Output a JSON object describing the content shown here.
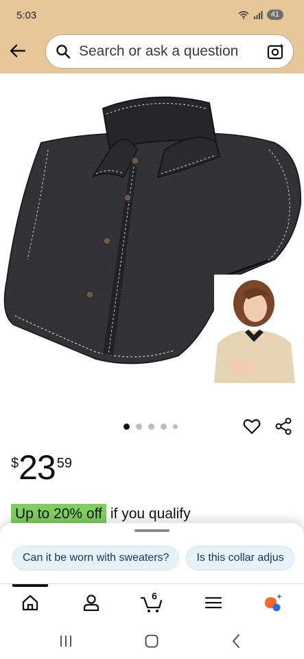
{
  "status_bar": {
    "time": "5:03",
    "battery": "41"
  },
  "search": {
    "placeholder": "Search or ask a question"
  },
  "product": {
    "carousel_dots": 5,
    "active_dot": 0,
    "price": {
      "symbol": "$",
      "whole": "23",
      "fraction": "59"
    },
    "deal": {
      "badge": "Up to 20% off",
      "text": "if you qualify"
    }
  },
  "suggestions": [
    "Can it be worn with sweaters?",
    "Is this collar adjus"
  ],
  "nav": {
    "cart_count": "6"
  },
  "colors": {
    "header_bg": "#e7c79a",
    "deal_badge": "#7fcf5f",
    "chip_bg": "#e6f1f8"
  }
}
